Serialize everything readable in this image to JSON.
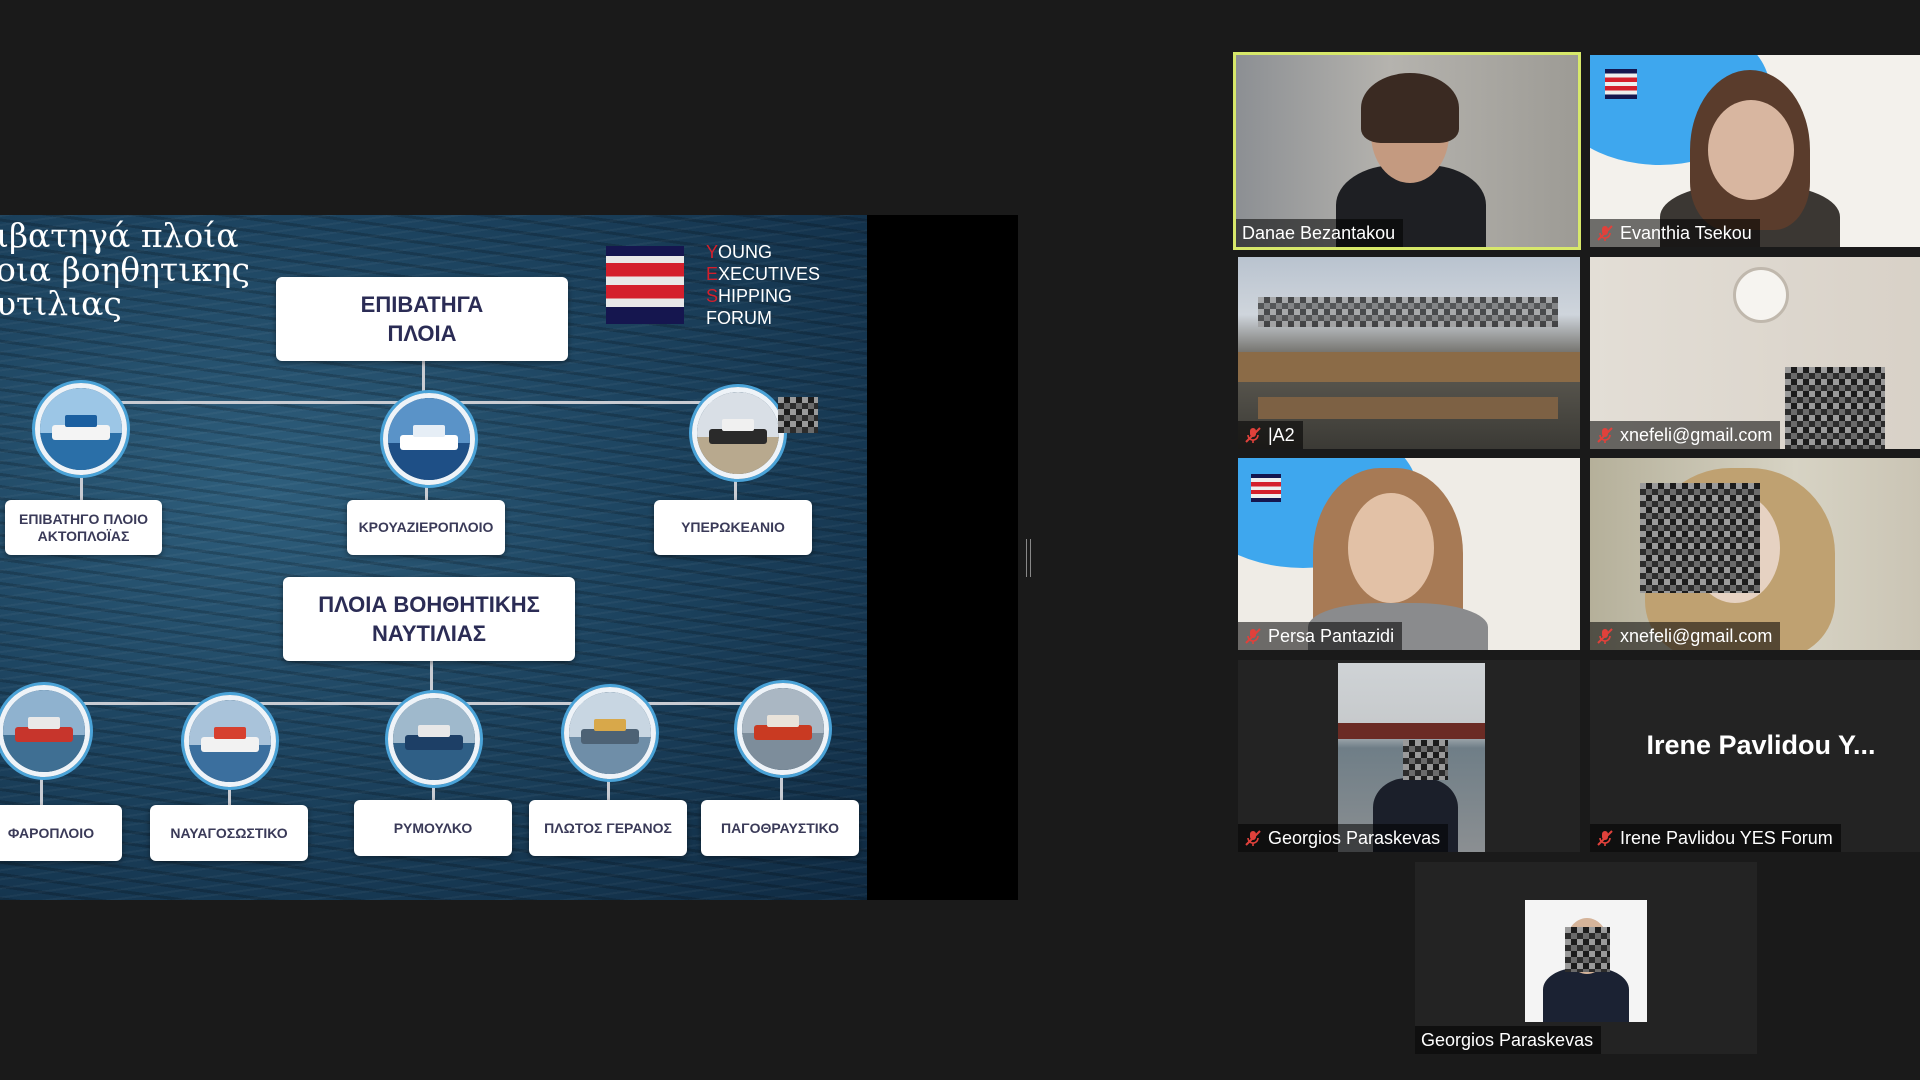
{
  "slide": {
    "title_lines": [
      "ιβατηγά πλοία",
      "οια βοηθητικης",
      "υτιλιας"
    ],
    "logo_words": [
      {
        "first": "Y",
        "rest": "OUNG"
      },
      {
        "first": "E",
        "rest": "XECUTIVES"
      },
      {
        "first": "S",
        "rest": "HIPPING"
      },
      {
        "first": "",
        "rest": "FORUM"
      }
    ],
    "passenger_heading": [
      "ΕΠΙΒΑΤΗΓΑ",
      "ΠΛΟΙΑ"
    ],
    "auxiliary_heading": [
      "ΠΛΟΙΑ ΒΟΗΘΗΤΙΚΗΣ",
      "ΝΑΥΤΙΛΙΑΣ"
    ],
    "passenger_items": [
      {
        "label_lines": [
          "ΕΠΙΒΑΤΗΓΟ ΠΛΟΙΟ",
          "ΑΚΤΟΠΛΟΪΑΣ"
        ],
        "icon": "ferry-icon"
      },
      {
        "label_lines": [
          "ΚΡΟΥΑΖΙΕΡΟΠΛΟΙΟ"
        ],
        "icon": "cruise-ship-icon"
      },
      {
        "label_lines": [
          "ΥΠΕΡΩΚΕΑΝΙΟ"
        ],
        "icon": "ocean-liner-icon"
      }
    ],
    "auxiliary_items": [
      {
        "label": "ΦΑΡΟΠΛΟΙΟ",
        "icon": "lightship-icon"
      },
      {
        "label": "ΝΑΥΑΓΟΣΩΣΤΙΚΟ",
        "icon": "lifeboat-icon"
      },
      {
        "label": "ΡΥΜΟΥΛΚΟ",
        "icon": "tugboat-icon"
      },
      {
        "label": "ΠΛΩΤΟΣ ΓΕΡΑΝΟΣ",
        "icon": "floating-crane-icon"
      },
      {
        "label": "ΠΑΓΟΘΡΑΥΣΤΙΚΟ",
        "icon": "icebreaker-icon"
      }
    ]
  },
  "participants": [
    {
      "name": "Danae Bezantakou",
      "muted": false,
      "active_speaker": true,
      "icon": "video-feed"
    },
    {
      "name": "Evanthia Tsekou",
      "muted": true,
      "active_speaker": false,
      "icon": "video-feed"
    },
    {
      "name": "|A2",
      "muted": true,
      "active_speaker": false,
      "icon": "video-feed"
    },
    {
      "name": "xnefeli@gmail.com",
      "muted": true,
      "active_speaker": false,
      "icon": "video-feed"
    },
    {
      "name": "Persa Pantazidi",
      "muted": true,
      "active_speaker": false,
      "icon": "video-feed"
    },
    {
      "name": "xnefeli@gmail.com",
      "muted": true,
      "active_speaker": false,
      "icon": "video-feed"
    },
    {
      "name": "Georgios Paraskevas",
      "muted": true,
      "active_speaker": false,
      "icon": "video-feed"
    },
    {
      "name": "Irene Pavlidou YES Forum",
      "muted": true,
      "active_speaker": false,
      "display_text": "Irene Pavlidou Y...",
      "icon": "name-placeholder"
    },
    {
      "name": "Georgios Paraskevas",
      "muted": false,
      "active_speaker": false,
      "icon": "profile-photo"
    }
  ],
  "colors": {
    "active_border": "#d7e86a",
    "mute_red": "#e0413b",
    "logo_red": "#d41f2c",
    "logo_navy": "#15164f"
  }
}
